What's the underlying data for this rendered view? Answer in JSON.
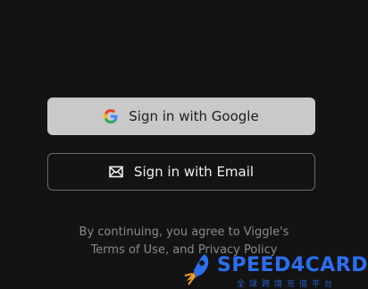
{
  "buttons": {
    "google_label": "Sign in with Google",
    "email_label": "Sign in with Email"
  },
  "terms": {
    "line1": "By continuing, you agree to Viggle's",
    "terms_link": "Terms of Use",
    "separator": ", and ",
    "privacy_link": "Privacy Policy"
  },
  "watermark": {
    "brand": "SPEED4CARD",
    "subtitle": "全球跨境充值平台"
  },
  "colors": {
    "background": "#131313",
    "google_button_bg": "#c9c9c9",
    "email_button_border": "#6a6a6a",
    "muted_text": "#8a8a8a",
    "watermark": "#2b6ff0"
  }
}
